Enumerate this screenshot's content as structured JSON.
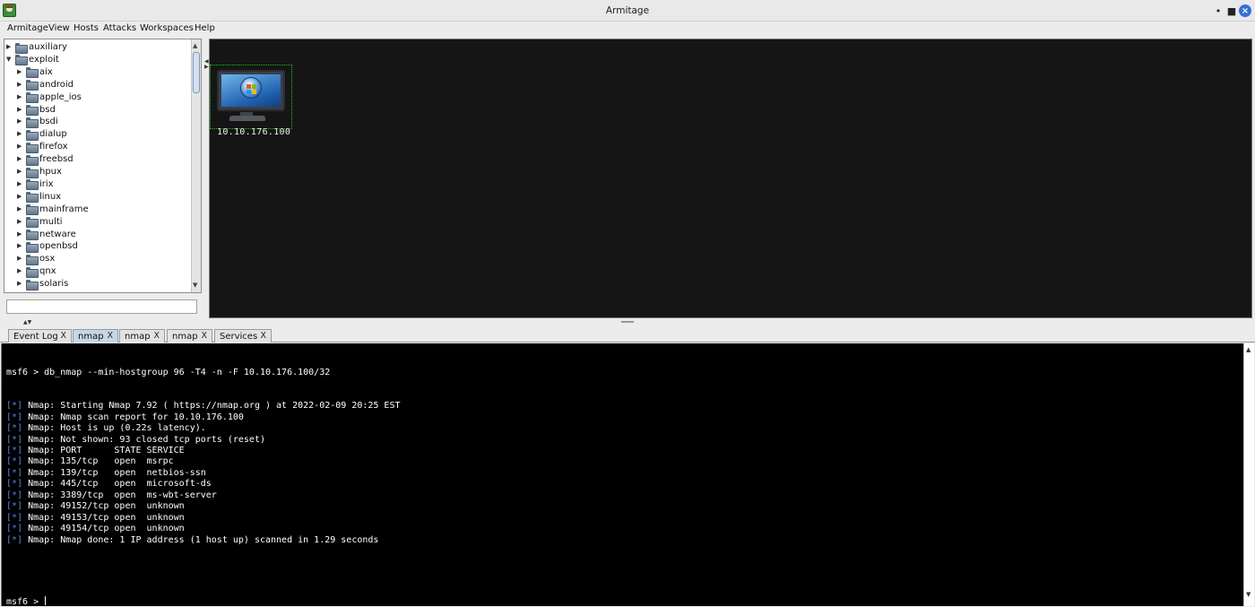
{
  "window": {
    "title": "Armitage"
  },
  "menu": [
    "Armitage",
    "View",
    "Hosts",
    "Attacks",
    "Workspaces",
    "Help"
  ],
  "module_tree": {
    "roots": [
      {
        "label": "auxiliary",
        "expanded": false
      },
      {
        "label": "exploit",
        "expanded": true
      }
    ],
    "exploit_children": [
      "aix",
      "android",
      "apple_ios",
      "bsd",
      "bsdi",
      "dialup",
      "firefox",
      "freebsd",
      "hpux",
      "irix",
      "linux",
      "mainframe",
      "multi",
      "netware",
      "openbsd",
      "osx",
      "qnx",
      "solaris"
    ]
  },
  "module_search": {
    "value": ""
  },
  "hosts_graph": {
    "hosts": [
      {
        "address": "10.10.176.100",
        "os_icon": "windows-monitor-icon",
        "selected": true
      }
    ]
  },
  "tabs": [
    {
      "label": "Event Log",
      "close": "X",
      "active": false
    },
    {
      "label": "nmap",
      "close": "X",
      "active": true
    },
    {
      "label": "nmap",
      "close": "X",
      "active": false
    },
    {
      "label": "nmap",
      "close": "X",
      "active": false
    },
    {
      "label": "Services",
      "close": "X",
      "active": false
    }
  ],
  "console": {
    "command_line": "msf6 > db_nmap --min-hostgroup 96 -T4 -n -F 10.10.176.100/32",
    "output": [
      {
        "tag": "[*]",
        "text": " Nmap: Starting Nmap 7.92 ( https://nmap.org ) at 2022-02-09 20:25 EST"
      },
      {
        "tag": "[*]",
        "text": " Nmap: Nmap scan report for 10.10.176.100"
      },
      {
        "tag": "[*]",
        "text": " Nmap: Host is up (0.22s latency)."
      },
      {
        "tag": "[*]",
        "text": " Nmap: Not shown: 93 closed tcp ports (reset)"
      },
      {
        "tag": "[*]",
        "text": " Nmap: PORT      STATE SERVICE"
      },
      {
        "tag": "[*]",
        "text": " Nmap: 135/tcp   open  msrpc"
      },
      {
        "tag": "[*]",
        "text": " Nmap: 139/tcp   open  netbios-ssn"
      },
      {
        "tag": "[*]",
        "text": " Nmap: 445/tcp   open  microsoft-ds"
      },
      {
        "tag": "[*]",
        "text": " Nmap: 3389/tcp  open  ms-wbt-server"
      },
      {
        "tag": "[*]",
        "text": " Nmap: 49152/tcp open  unknown"
      },
      {
        "tag": "[*]",
        "text": " Nmap: 49153/tcp open  unknown"
      },
      {
        "tag": "[*]",
        "text": " Nmap: 49154/tcp open  unknown"
      },
      {
        "tag": "[*]",
        "text": " Nmap: Nmap done: 1 IP address (1 host up) scanned in 1.29 seconds"
      }
    ],
    "prompt": "msf6 > "
  },
  "colors": {
    "console_bg": "#000000",
    "tag": "#5f7fe0",
    "graph_bg": "#151515",
    "active_tab": "#c8d5e6",
    "selection": "#1ec41e"
  }
}
